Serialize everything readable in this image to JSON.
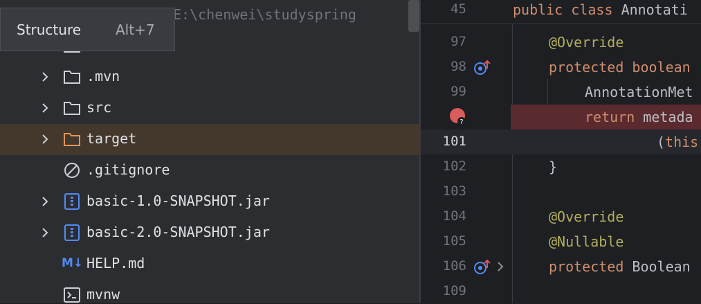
{
  "project": {
    "path_text": "E:\\chenwei\\studyspring",
    "tooltip": {
      "label": "Structure",
      "shortcut": "Alt+7"
    },
    "items": [
      {
        "label": ".mvn",
        "icon": "folder-icon",
        "chevron": true,
        "selected": false
      },
      {
        "label": "src",
        "icon": "folder-icon",
        "chevron": true,
        "selected": false
      },
      {
        "label": "target",
        "icon": "folder-orange-icon",
        "chevron": true,
        "selected": true
      },
      {
        "label": ".gitignore",
        "icon": "ignore-file-icon",
        "chevron": false,
        "selected": false
      },
      {
        "label": "basic-1.0-SNAPSHOT.jar",
        "icon": "jar-icon",
        "chevron": true,
        "selected": false
      },
      {
        "label": "basic-2.0-SNAPSHOT.jar",
        "icon": "jar-icon",
        "chevron": true,
        "selected": false
      },
      {
        "label": "HELP.md",
        "icon": "markdown-icon",
        "icon_text": "M↓",
        "chevron": false,
        "selected": false
      },
      {
        "label": "mvnw",
        "icon": "terminal-icon",
        "chevron": false,
        "selected": false
      }
    ]
  },
  "editor": {
    "sticky": {
      "line_number": "45",
      "text": "public class Annotati"
    },
    "lines": [
      {
        "number": "97",
        "text": "@Override"
      },
      {
        "number": "98",
        "text": "protected boolean"
      },
      {
        "number": "99",
        "text": "AnnotationMet"
      },
      {
        "number": "",
        "text": "return metada"
      },
      {
        "number": "101",
        "text": "(this"
      },
      {
        "number": "102",
        "text": "}"
      },
      {
        "number": "103",
        "text": ""
      },
      {
        "number": "104",
        "text": "@Override"
      },
      {
        "number": "105",
        "text": "@Nullable"
      },
      {
        "number": "106",
        "text": "protected Boolean"
      },
      {
        "number": "109",
        "text": ""
      }
    ]
  },
  "colors": {
    "keyword": "#cf8e6d",
    "annotation": "#b3ae60",
    "selection": "#43382b",
    "breakpoint_line": "#5a2a2f"
  }
}
